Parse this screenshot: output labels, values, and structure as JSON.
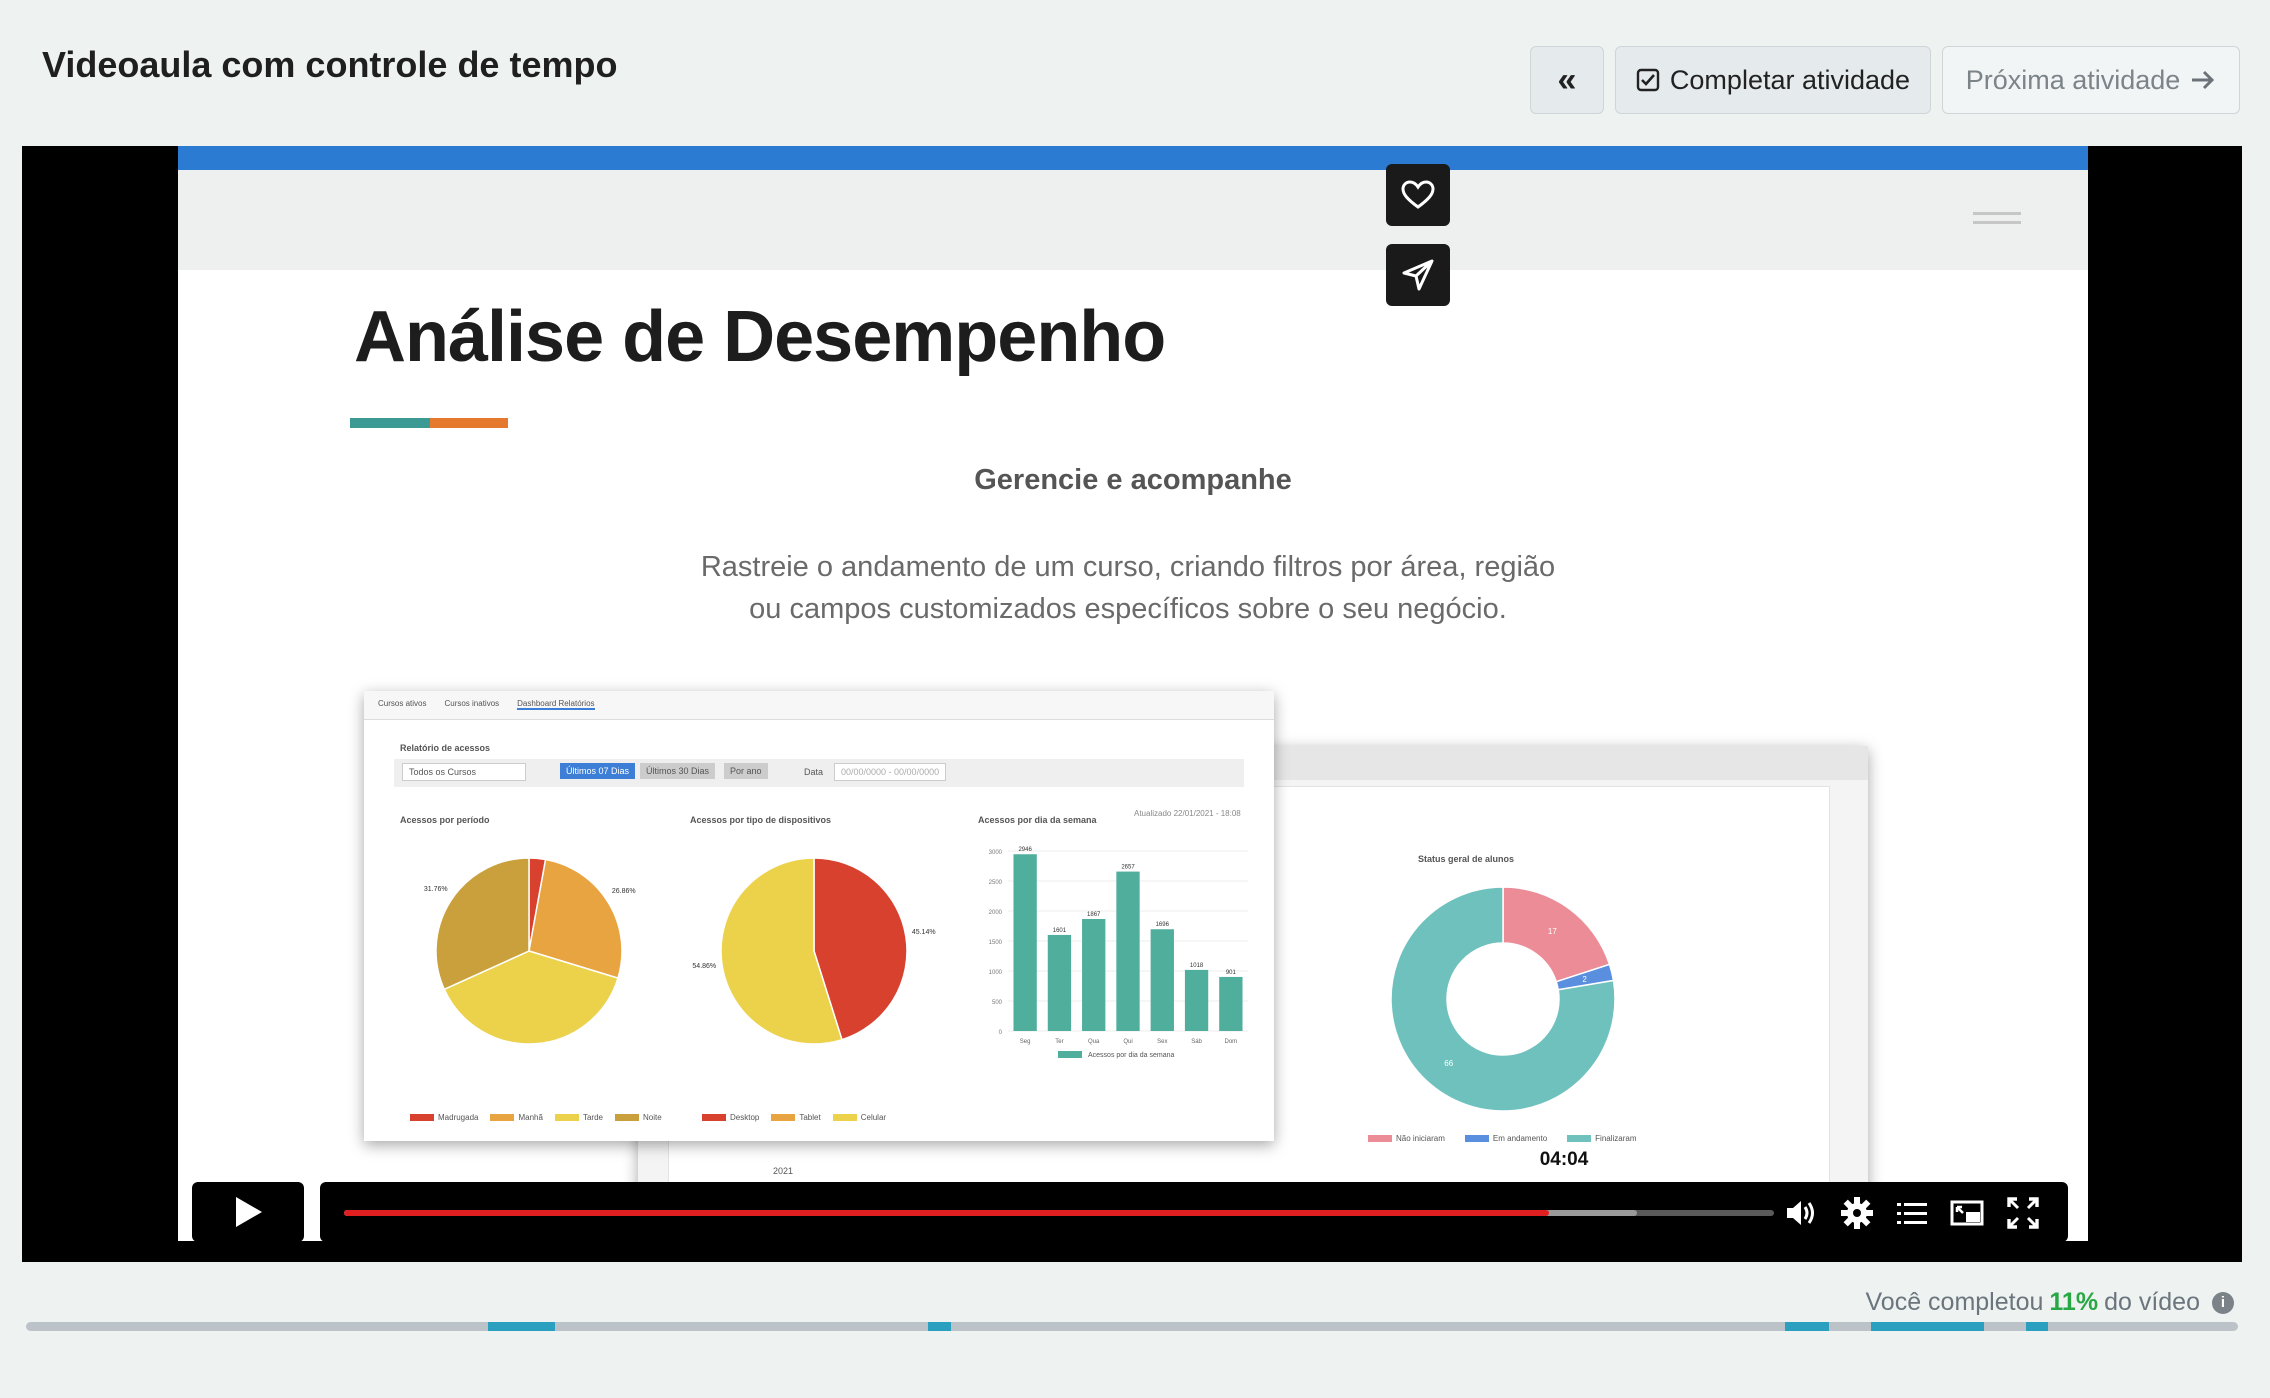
{
  "header": {
    "title": "Videoaula com controle de tempo",
    "back_label": "«",
    "complete_label": "Completar atividade",
    "next_label": "Próxima atividade"
  },
  "slide": {
    "title": "Análise de Desempenho",
    "subtitle": "Gerencie e acompanhe",
    "description_line1": "Rastreie o andamento de um curso, criando filtros por área, região",
    "description_line2": "ou campos customizados específicos sobre o seu negócio.",
    "tabs": [
      "Cursos ativos",
      "Cursos inativos",
      "Dashboard Relatórios"
    ],
    "report_title": "Relatório de acessos",
    "filter_course": "Todos os Cursos",
    "filter_btn1": "Últimos 07 Dias",
    "filter_btn2": "Últimos 30 Dias",
    "filter_btn3": "Por ano",
    "filter_date_label": "Data",
    "filter_date_value": "00/00/0000 - 00/00/0000",
    "chart1_title": "Acessos por período",
    "chart2_title": "Acessos por tipo de dispositivos",
    "chart3_title": "Acessos por dia da semana",
    "chart4_title": "Status geral de alunos",
    "updated_label": "Atualizado 22/01/2021 - 18:08",
    "year_select": "2021"
  },
  "chart_data": [
    {
      "type": "pie",
      "title": "Acessos por período",
      "labels": [
        "Madrugada",
        "Manhã",
        "Tarde",
        "Noite"
      ],
      "values": [
        2.85,
        26.86,
        38.53,
        31.76
      ],
      "colors": [
        "#d9412f",
        "#e8a440",
        "#ecd14a",
        "#c9a03c"
      ]
    },
    {
      "type": "pie",
      "title": "Acessos por tipo de dispositivos",
      "labels": [
        "Desktop",
        "Tablet",
        "Celular"
      ],
      "values": [
        45.14,
        0,
        54.86
      ],
      "colors": [
        "#d9412f",
        "#e8a440",
        "#ecd14a"
      ]
    },
    {
      "type": "bar",
      "title": "Acessos por dia da semana",
      "categories": [
        "Seg",
        "Ter",
        "Qua",
        "Qui",
        "Sex",
        "Sáb",
        "Dom"
      ],
      "series": [
        {
          "name": "Acessos por dia da semana",
          "values": [
            2946,
            1601,
            1867,
            2657,
            1696,
            1018,
            901
          ]
        }
      ],
      "ylim": [
        0,
        3000
      ],
      "yticks": [
        0,
        500,
        1000,
        1500,
        2000,
        2500,
        3000
      ],
      "color": "#4fae9c"
    },
    {
      "type": "pie",
      "title": "Status geral de alunos",
      "labels": [
        "Não iniciaram",
        "Em andamento",
        "Finalizaram"
      ],
      "values": [
        17,
        2,
        66
      ],
      "colors": [
        "#ec8c97",
        "#5a8fe0",
        "#6fc1bd"
      ]
    }
  ],
  "player": {
    "current_time": "04:04",
    "played_fraction": 0.8425,
    "buffered_fraction": 0.9045,
    "play_icon": "play-icon",
    "volume_icon": "volume-icon",
    "settings_icon": "gear-icon",
    "chapters_icon": "list-icon",
    "pip_icon": "picture-in-picture-icon",
    "fullscreen_icon": "fullscreen-icon",
    "like_icon": "heart-icon",
    "share_icon": "send-icon"
  },
  "progress": {
    "prefix": "Você completou",
    "percent": "11%",
    "suffix": "do vídeo",
    "watched_segments": [
      [
        0.209,
        0.239
      ],
      [
        0.408,
        0.418
      ],
      [
        0.795,
        0.815
      ],
      [
        0.834,
        0.885
      ],
      [
        0.904,
        0.914
      ]
    ]
  },
  "colors": {
    "accent": "#2b7bd3",
    "played": "#e02020",
    "watched": "#2b9fc0",
    "percent": "#28a745"
  }
}
